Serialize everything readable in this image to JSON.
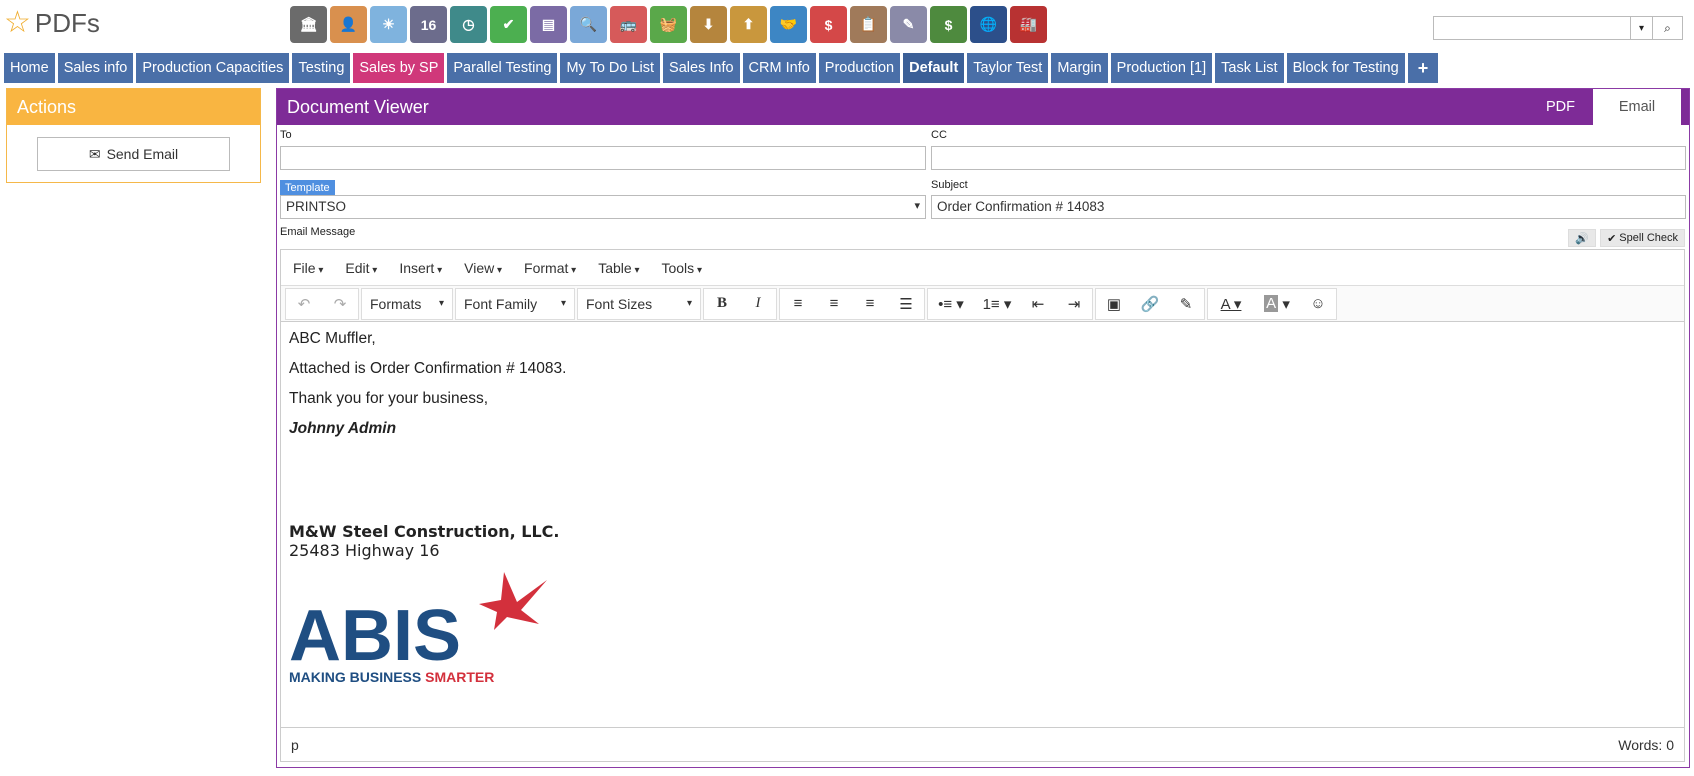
{
  "header": {
    "title": "PDFs",
    "icons": [
      "bank-icon",
      "user-icon",
      "weather-icon",
      "calendar-icon",
      "clock-icon",
      "check-icon",
      "report-icon",
      "search-zoom-icon",
      "truck-icon",
      "basket-icon",
      "inbox-download-icon",
      "outbox-upload-icon",
      "handshake-icon",
      "quote-icon",
      "clipboard-icon",
      "pencil-icon",
      "money-icon",
      "globe-icon",
      "factory-icon"
    ],
    "calendar_day": "16"
  },
  "search": {
    "placeholder": ""
  },
  "tabs": [
    {
      "label": "Home"
    },
    {
      "label": "Sales info"
    },
    {
      "label": "Production Capacities"
    },
    {
      "label": "Testing"
    },
    {
      "label": "Sales by SP"
    },
    {
      "label": "Parallel Testing"
    },
    {
      "label": "My To Do List"
    },
    {
      "label": "Sales Info"
    },
    {
      "label": "CRM Info"
    },
    {
      "label": "Production"
    },
    {
      "label": "Default"
    },
    {
      "label": "Taylor Test"
    },
    {
      "label": "Margin"
    },
    {
      "label": "Production [1]"
    },
    {
      "label": "Task List"
    },
    {
      "label": "Block for Testing"
    },
    {
      "label": "+"
    }
  ],
  "actions": {
    "title": "Actions",
    "send_email": "Send Email"
  },
  "viewer": {
    "title": "Document Viewer",
    "tab_pdf": "PDF",
    "tab_email": "Email",
    "to_label": "To",
    "to_value": "",
    "cc_label": "CC",
    "cc_value": "",
    "template_label": "Template",
    "template_value": "PRINTSO",
    "subject_label": "Subject",
    "subject_value": "Order Confirmation # 14083",
    "message_label": "Email Message",
    "spell_check": "Spell Check"
  },
  "editor": {
    "menu": [
      "File",
      "Edit",
      "Insert",
      "View",
      "Format",
      "Table",
      "Tools"
    ],
    "formats": "Formats",
    "font_family": "Font Family",
    "font_sizes": "Font Sizes",
    "body": {
      "greeting": "ABC Muffler,",
      "line1": "Attached is Order Confirmation # 14083.",
      "line2": "Thank you for your business,",
      "signature": "Johnny Admin",
      "company_name": "M&W Steel Construction, LLC.",
      "company_address": "25483 Highway 16",
      "logo_text": "ABIS",
      "logo_tagline_1": "MAKING BUSINESS ",
      "logo_tagline_2": "SMARTER"
    },
    "status_path": "p",
    "word_count": "Words: 0"
  },
  "colors": {
    "nav": "#4a6fa8",
    "nav_active": "#d0387a",
    "viewer_header": "#7e2b97",
    "actions_header": "#f9b541"
  }
}
